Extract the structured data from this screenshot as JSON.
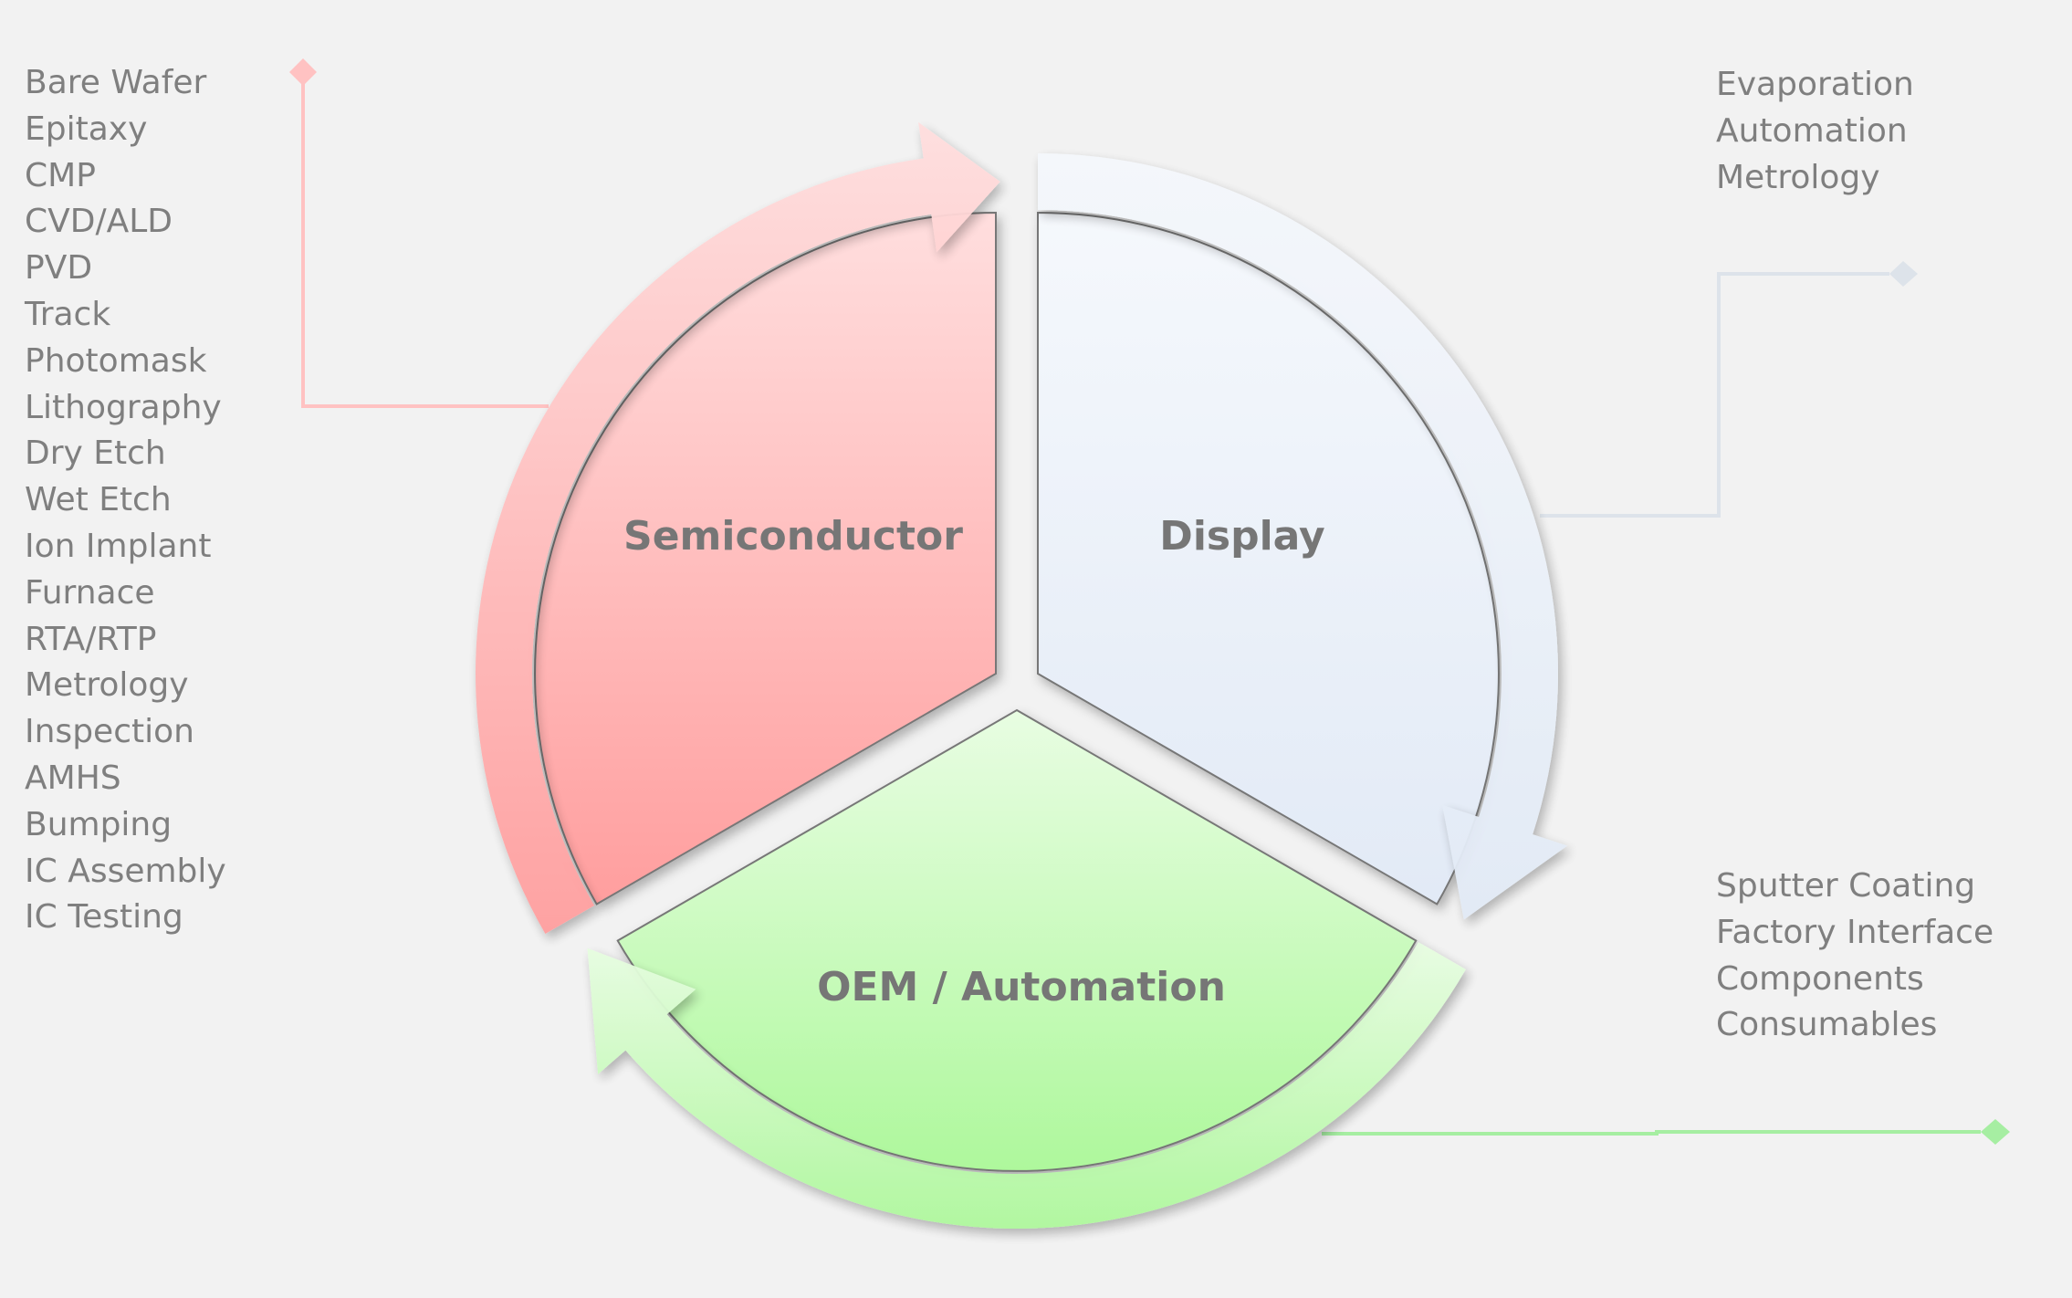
{
  "segments": {
    "semiconductor": {
      "label": "Semiconductor",
      "color_top": "#ffdede",
      "color_bottom": "#ff9e9e",
      "connector_color": "#ffc2c2"
    },
    "display": {
      "label": "Display",
      "color_top": "#f5f8fc",
      "color_bottom": "#e2eaf6",
      "connector_color": "#dde3ea"
    },
    "oem": {
      "label": "OEM / Automation",
      "color_top": "#e8fde2",
      "color_bottom": "#aef89c",
      "connector_color": "#a6eea2"
    }
  },
  "lists": {
    "semiconductor": [
      "Bare Wafer",
      "Epitaxy",
      "CMP",
      "CVD/ALD",
      "PVD",
      "Track",
      "Photomask",
      "Lithography",
      "Dry Etch",
      "Wet Etch",
      "Ion Implant",
      "Furnace",
      "RTA/RTP",
      "Metrology",
      "Inspection",
      "AMHS",
      "Bumping",
      "IC Assembly",
      "IC Testing"
    ],
    "display": [
      "Evaporation",
      "Automation",
      "Metrology"
    ],
    "oem": [
      "Sputter Coating",
      "Factory Interface",
      "Components",
      "Consumables"
    ]
  }
}
